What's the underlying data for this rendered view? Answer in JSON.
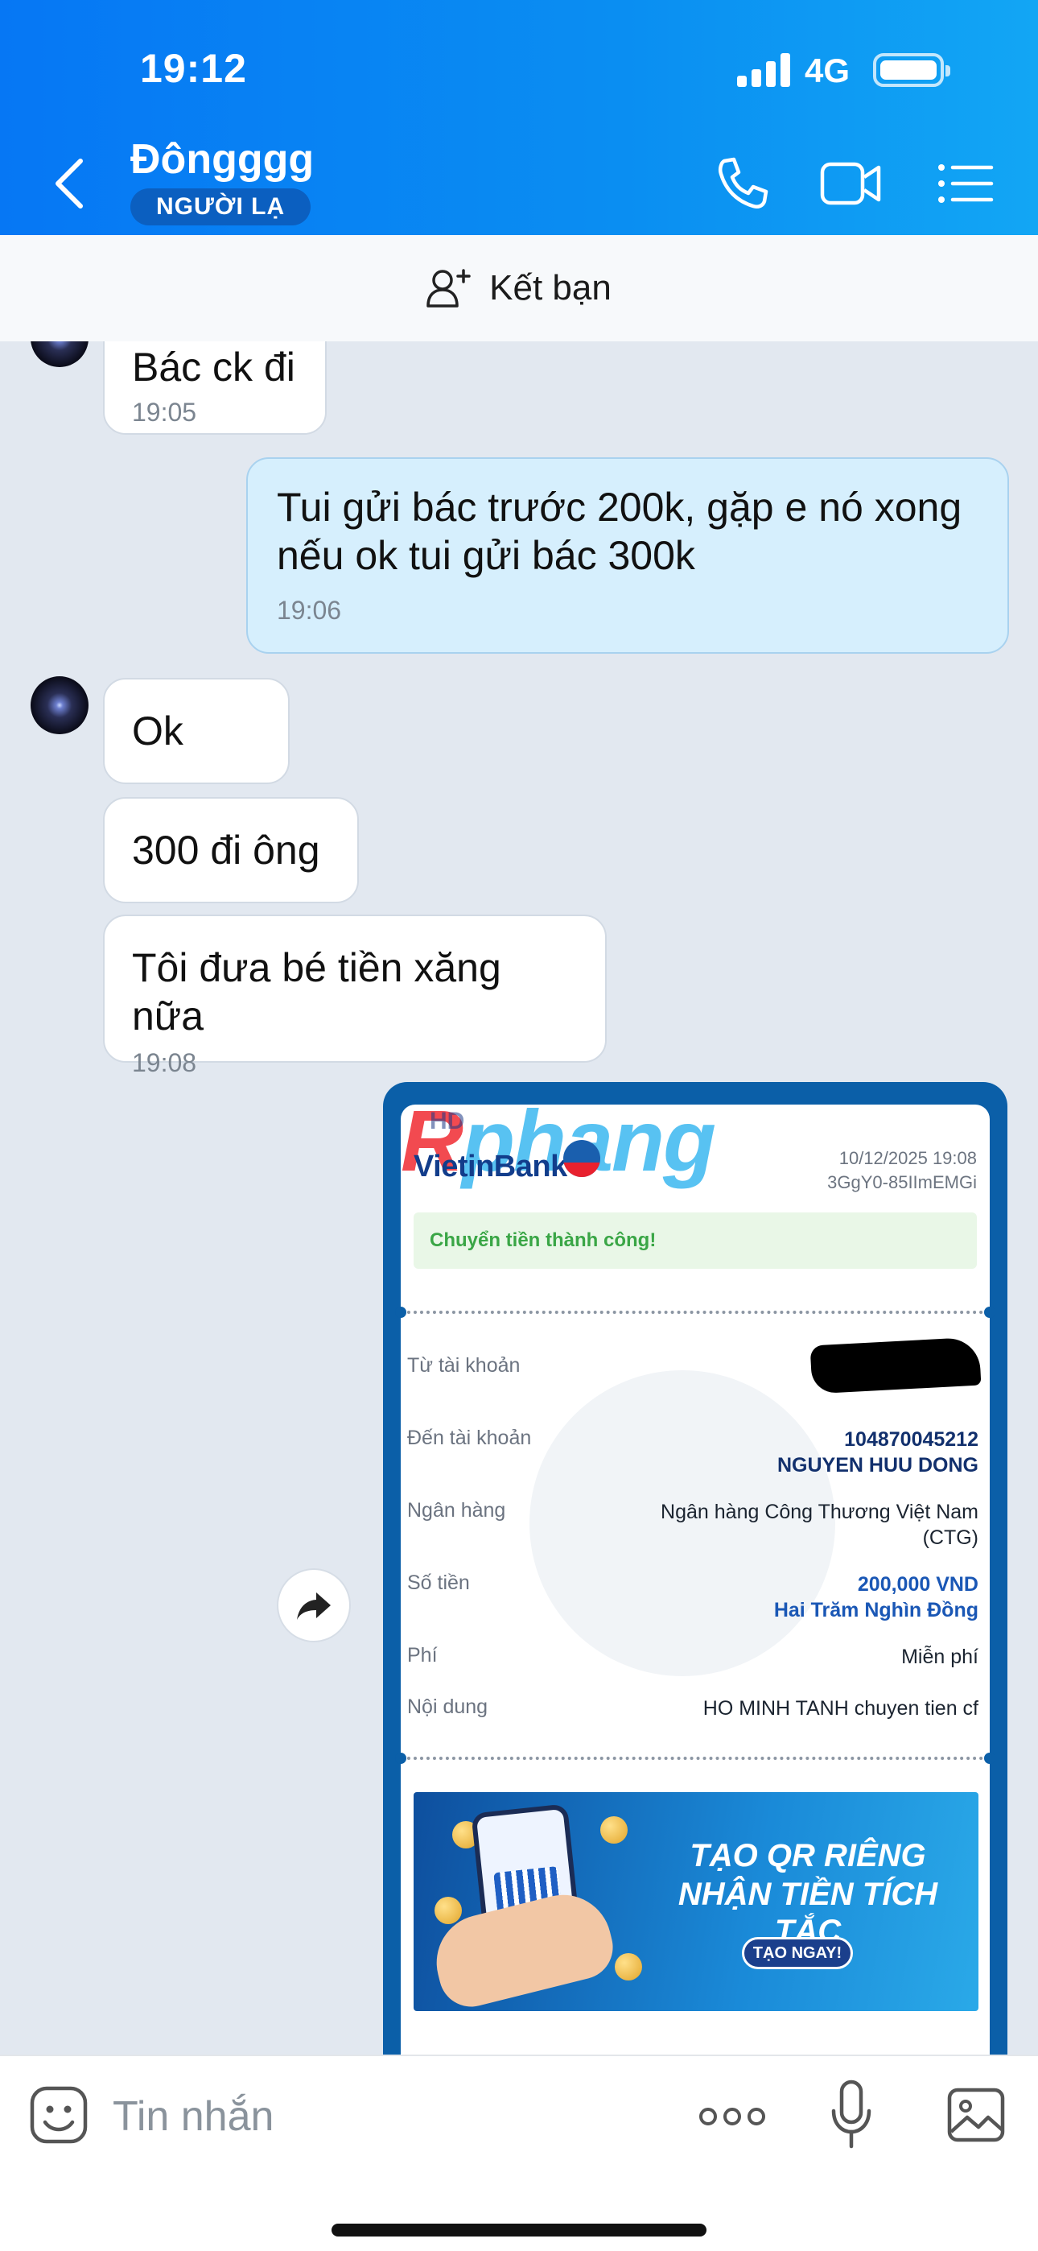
{
  "status_bar": {
    "time": "19:12",
    "network": "4G"
  },
  "header": {
    "contact_name": "Đôngggg",
    "badge": "NGƯỜI LẠ"
  },
  "friend_bar": {
    "label": "Kết bạn"
  },
  "messages": [
    {
      "direction": "in",
      "text": "Bác ck đi",
      "time": "19:05"
    },
    {
      "direction": "out",
      "text_line1": "Tui gửi bác trước 200k, gặp e nó xong",
      "text_line2": "nếu ok tui gửi bác 300k",
      "time": "19:06"
    },
    {
      "direction": "in",
      "text": "Ok"
    },
    {
      "direction": "in",
      "text": "300 đi ông"
    },
    {
      "direction": "in",
      "text": "Tôi đưa bé tiền xăng nữa",
      "time": "19:08"
    }
  ],
  "receipt": {
    "watermark_part1": "R",
    "watermark_part2": "phang",
    "watermark_small": "HD",
    "bank_name": "VietinBank",
    "datetime": "10/12/2025 19:08",
    "transaction_code": "3GgY0-85IImEMGi",
    "status": "Chuyển tiền thành công!",
    "rows": {
      "from_label": "Từ tài khoản",
      "to_label": "Đến tài khoản",
      "to_account": "104870045212",
      "to_name": "NGUYEN HUU DONG",
      "bank_label": "Ngân hàng",
      "bank_value_line1": "Ngân hàng Công Thương Việt Nam",
      "bank_value_line2": "(CTG)",
      "amount_label": "Số tiền",
      "amount_value": "200,000 VND",
      "amount_words": "Hai Trăm Nghìn Đồng",
      "fee_label": "Phí",
      "fee_value": "Miễn phí",
      "content_label": "Nội dung",
      "content_value": "HO MINH TANH chuyen tien cf"
    },
    "banner": {
      "line1": "TẠO QR RIÊNG",
      "line2": "NHẬN TIỀN TÍCH TẮC",
      "button": "TẠO NGAY!"
    }
  },
  "input_bar": {
    "placeholder": "Tin nhắn"
  },
  "colors": {
    "header_blue": "#0677f4",
    "outgoing_bubble": "#d6effd",
    "chat_background": "#e2e8f0",
    "success_green": "#3aa646"
  },
  "icons": [
    "back-icon",
    "phone-icon",
    "video-call-icon",
    "menu-list-icon",
    "add-friend-icon",
    "forward-icon",
    "sticker-icon",
    "more-icon",
    "microphone-icon",
    "image-icon"
  ]
}
